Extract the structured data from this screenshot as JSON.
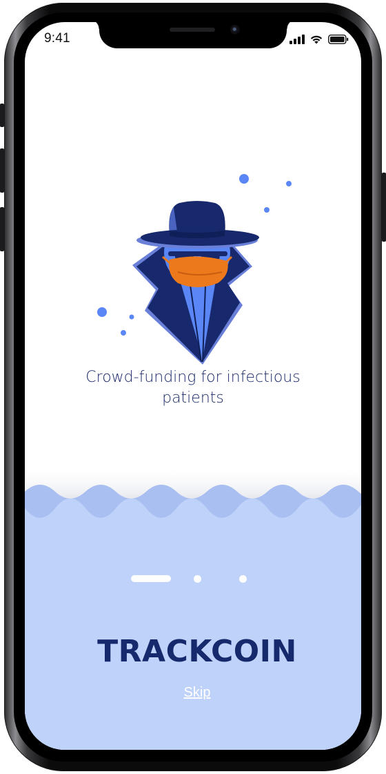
{
  "status_bar": {
    "time": "9:41"
  },
  "onboarding": {
    "headline": "Crowd-funding for infectious patients",
    "brand": "TRACKCOIN",
    "skip_label": "Skip",
    "pager": {
      "total_pages": 3,
      "current_page": 1
    }
  },
  "icons": {
    "illustration": "masked-spy-icon",
    "signal": "cellular-signal-icon",
    "wifi": "wifi-icon",
    "battery": "battery-icon"
  },
  "colors": {
    "brand_navy": "#16296c",
    "headline_text": "#1c2a6a",
    "panel_blue": "#bfd2fa",
    "wave_blue": "#a9bff2",
    "accent_blue": "#5b87f6",
    "mask_orange": "#ec7a1c"
  }
}
